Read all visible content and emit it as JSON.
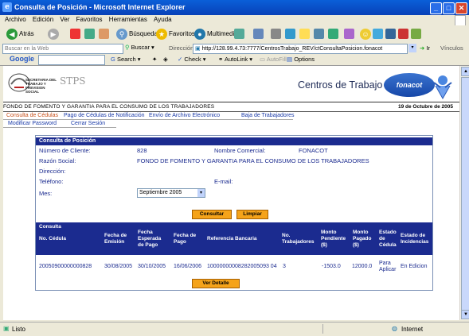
{
  "window": {
    "title": "Consulta de Posición - Microsoft Internet Explorer"
  },
  "menu": [
    "Archivo",
    "Edición",
    "Ver",
    "Favoritos",
    "Herramientas",
    "Ayuda"
  ],
  "toolbar": {
    "back": "Atrás",
    "search": "Búsqueda",
    "favorites": "Favoritos",
    "media": "Multimedia"
  },
  "searchrow": {
    "label": "Buscar en la Web",
    "search_btn": "Buscar",
    "address_label": "Dirección",
    "url": "http://128.99.4.73:7777/CentrosTrabajo_REV/ctConsultaPosicion.fonacot",
    "go": "Ir",
    "links": "Vínculos"
  },
  "googlebar": {
    "logo": "Google",
    "search": "Search",
    "check": "Check",
    "autolink": "AutoLink",
    "autofill": "AutoFill",
    "options": "Options"
  },
  "header": {
    "stps_text": "SECRETARIA DEL TRABAJO Y PREVISION SOCIAL",
    "stps_abbr": "STPS",
    "site_title": "Centros de Trabajo",
    "fonacot_logo": "fonacot",
    "institution": "FONDO DE FOMENTO Y GARANTIA PARA EL CONSUMO DE LOS TRABAJADORES",
    "date": "19 de Octubre de 2005"
  },
  "nav": {
    "consulta": "Consulta de Cédulas",
    "pago": "Pago de Cédulas de Notificación",
    "envio": "Envío de Archivo Electrónico",
    "baja": "Baja de Trabajadores",
    "modificar": "Modificar Password",
    "cerrar": "Cerrar Sesión"
  },
  "form": {
    "header": "Consulta de Posición",
    "num_cliente_label": "Número de Cliente:",
    "num_cliente": "828",
    "nombre_comercial_label": "Nombre Comercial:",
    "nombre_comercial": "FONACOT",
    "razon_social_label": "Razón Social:",
    "razon_social": "FONDO DE FOMENTO Y GARANTIA PARA EL CONSUMO DE LOS TRABAJADORES",
    "direccion_label": "Dirección:",
    "telefono_label": "Teléfono:",
    "email_label": "E-mail:",
    "mes_label": "Mes:",
    "mes_value": "Septiembre 2005",
    "consultar": "Consultar",
    "limpiar": "Limpiar"
  },
  "consulta": {
    "header": "Consulta",
    "columns": [
      "No. Cédula",
      "Fecha de Emisión",
      "Fecha Esperada de Pago",
      "Fecha de Pago",
      "Referencia Bancaria",
      "No. Trabajadores",
      "Monto Pendiente ($)",
      "Monto Pagado ($)",
      "Estado de Cédula",
      "Estado de Incidencias"
    ],
    "rows": [
      [
        "20050900000000828",
        "30/08/2005",
        "30/10/2005",
        "16/06/2006",
        "10000000008282005093 04",
        "3",
        "-1503.0",
        "12000.0",
        "Para Aplicar",
        "En Edicion"
      ]
    ],
    "ver_detalle": "Ver Detalle"
  },
  "status": {
    "left": "Listo",
    "zone": "Internet"
  }
}
